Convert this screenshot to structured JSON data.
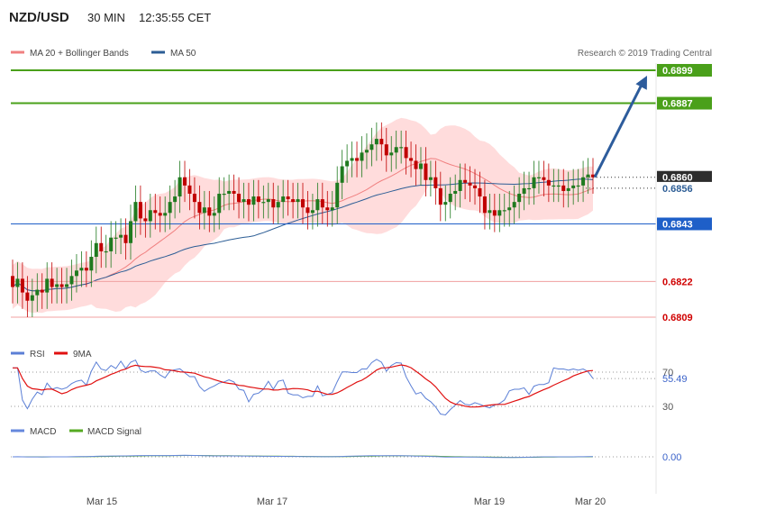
{
  "header": {
    "pair": "NZD/USD",
    "timeframe": "30 MIN",
    "time": "12:35:55 CET"
  },
  "legend": {
    "ma20_bb": "MA 20 + Bollinger Bands",
    "ma50": "MA 50",
    "credit": "Research © 2019 Trading Central"
  },
  "rsi_legend": {
    "rsi": "RSI",
    "ma": "9MA"
  },
  "macd_legend": {
    "macd": "MACD",
    "signal": "MACD Signal"
  },
  "colors": {
    "up_candle": "#1f7a1f",
    "down_candle": "#c00000",
    "bb_fill": "#ffd6d6",
    "bb_line": "#f08080",
    "ma50": "#2c5d95",
    "target_line": "#4aa01a",
    "pivot_line": "#1e5fc8",
    "support_line": "#f0a0a0",
    "arrow": "#2d5c9c",
    "rsi_line": "#5b7fd6",
    "rsi_ma": "#e01010",
    "macd_line": "#6688dd",
    "signal_line": "#55aa22"
  },
  "chart_data": {
    "type": "candlestick",
    "instrument": "NZD/USD",
    "interval": "30 MIN",
    "x_ticks": [
      "Mar 15",
      "Mar 17",
      "Mar 19",
      "Mar 20"
    ],
    "ylim": [
      0.6802,
      0.691
    ],
    "levels": [
      {
        "value": 0.6899,
        "label": "0.6899",
        "kind": "target"
      },
      {
        "value": 0.6887,
        "label": "0.6887",
        "kind": "target"
      },
      {
        "value": 0.686,
        "label": "0.6860",
        "kind": "last"
      },
      {
        "value": 0.6856,
        "label": "0.6856",
        "kind": "ma"
      },
      {
        "value": 0.6843,
        "label": "0.6843",
        "kind": "pivot"
      },
      {
        "value": 0.6822,
        "label": "0.6822",
        "kind": "support"
      },
      {
        "value": 0.6809,
        "label": "0.6809",
        "kind": "support"
      }
    ],
    "candles": {
      "open": [
        0.6824,
        0.682,
        0.6823,
        0.6818,
        0.6815,
        0.6817,
        0.6819,
        0.6818,
        0.6823,
        0.682,
        0.6821,
        0.682,
        0.6821,
        0.6824,
        0.6826,
        0.6827,
        0.6826,
        0.6831,
        0.6836,
        0.6833,
        0.6833,
        0.6838,
        0.6838,
        0.6839,
        0.6836,
        0.6844,
        0.6851,
        0.6845,
        0.6844,
        0.6848,
        0.6847,
        0.6846,
        0.6847,
        0.6851,
        0.6853,
        0.686,
        0.6857,
        0.6854,
        0.6851,
        0.6847,
        0.6849,
        0.6846,
        0.6847,
        0.6854,
        0.6854,
        0.6855,
        0.6854,
        0.6851,
        0.6852,
        0.685,
        0.6853,
        0.6851,
        0.6851,
        0.6852,
        0.6849,
        0.6851,
        0.6853,
        0.6852,
        0.6851,
        0.6852,
        0.6849,
        0.6847,
        0.6848,
        0.6852,
        0.6849,
        0.6848,
        0.6849,
        0.6858,
        0.6864,
        0.6866,
        0.6867,
        0.6866,
        0.6869,
        0.687,
        0.6872,
        0.6874,
        0.6872,
        0.6868,
        0.6869,
        0.6871,
        0.6871,
        0.6867,
        0.6866,
        0.6863,
        0.6865,
        0.6859,
        0.686,
        0.6856,
        0.685,
        0.6851,
        0.6854,
        0.6855,
        0.6859,
        0.6858,
        0.6857,
        0.6856,
        0.6853,
        0.6847,
        0.6848,
        0.6846,
        0.6848,
        0.6848,
        0.6849,
        0.6851,
        0.6854,
        0.6856,
        0.6856,
        0.686,
        0.686,
        0.6859,
        0.6857,
        0.6857,
        0.6857,
        0.6855,
        0.6856,
        0.6857,
        0.6857,
        0.686,
        0.6861
      ],
      "close": [
        0.682,
        0.6823,
        0.6818,
        0.6815,
        0.6817,
        0.6819,
        0.6818,
        0.6823,
        0.682,
        0.6821,
        0.682,
        0.6821,
        0.6824,
        0.6826,
        0.6827,
        0.6826,
        0.6831,
        0.6836,
        0.6833,
        0.6833,
        0.6838,
        0.6838,
        0.6839,
        0.6836,
        0.6844,
        0.6851,
        0.6845,
        0.6844,
        0.6848,
        0.6847,
        0.6846,
        0.6847,
        0.6851,
        0.6853,
        0.686,
        0.6857,
        0.6854,
        0.6851,
        0.6847,
        0.6849,
        0.6846,
        0.6847,
        0.6854,
        0.6854,
        0.6855,
        0.6854,
        0.6851,
        0.6852,
        0.685,
        0.6853,
        0.6851,
        0.6851,
        0.6852,
        0.6849,
        0.6851,
        0.6853,
        0.6852,
        0.6851,
        0.6852,
        0.6849,
        0.6847,
        0.6848,
        0.6852,
        0.6849,
        0.6848,
        0.6849,
        0.6858,
        0.6864,
        0.6866,
        0.6867,
        0.6866,
        0.6869,
        0.687,
        0.6872,
        0.6874,
        0.6872,
        0.6868,
        0.6869,
        0.6871,
        0.6871,
        0.6867,
        0.6866,
        0.6863,
        0.6865,
        0.6859,
        0.686,
        0.6856,
        0.685,
        0.6851,
        0.6854,
        0.6855,
        0.6859,
        0.6858,
        0.6857,
        0.6856,
        0.6853,
        0.6847,
        0.6848,
        0.6846,
        0.6848,
        0.6848,
        0.6849,
        0.6851,
        0.6854,
        0.6856,
        0.6856,
        0.686,
        0.686,
        0.6859,
        0.6857,
        0.6857,
        0.6857,
        0.6855,
        0.6856,
        0.6857,
        0.6857,
        0.686,
        0.6861,
        0.686
      ]
    },
    "ma20": [
      0.683,
      0.6828,
      0.6826,
      0.6825,
      0.6824,
      0.6823,
      0.6822,
      0.6822,
      0.6823,
      0.6824,
      0.6826,
      0.6828,
      0.683,
      0.6832,
      0.6834,
      0.6836,
      0.6838,
      0.684,
      0.6841,
      0.6842,
      0.6843,
      0.6844,
      0.6845,
      0.6846,
      0.6846,
      0.6847,
      0.6848,
      0.685,
      0.6852,
      0.6854,
      0.6856,
      0.6857,
      0.6858,
      0.686,
      0.6862,
      0.6864,
      0.6866,
      0.6867,
      0.6867,
      0.6866,
      0.6865,
      0.6863,
      0.6862,
      0.686,
      0.686,
      0.6859,
      0.6859,
      0.6858,
      0.6858,
      0.6858,
      0.6857,
      0.6857,
      0.6857,
      0.6857,
      0.6857,
      0.6857,
      0.6858,
      0.6858,
      0.6858,
      0.6858,
      0.6858,
      0.6858,
      0.6857,
      0.6858,
      0.6859,
      0.686,
      0.6861,
      0.6862,
      0.6863
    ],
    "x_label": "",
    "y_label": "",
    "targets_arrow": {
      "from": 0.686,
      "to": 0.6899
    }
  }
}
